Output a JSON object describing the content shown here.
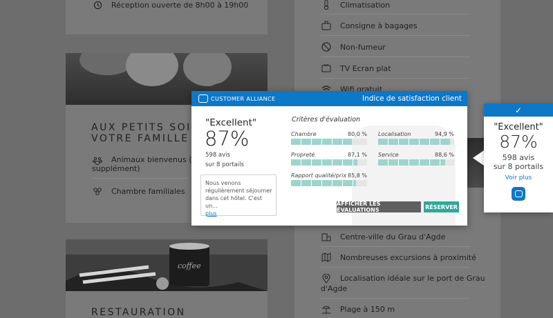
{
  "left_top": {
    "reception": "Réception ouverte de 8h00 à 19h00"
  },
  "section_kids": {
    "heading": "AUX PETITS SOINS POUR VOTRE FAMILLE",
    "heading_line1": "AUX PETITS SOIN",
    "heading_line2": "VOTRE FAMILLE",
    "pets_line1": "Animaux bienvenus (sa",
    "pets_line2": "supplément)",
    "family_rooms": "Chambre familiales"
  },
  "section_restaurant": {
    "heading": "RESTAURATION"
  },
  "right_column": {
    "top_items": [
      {
        "icon": "thermometer-icon",
        "label": "Climatisation"
      },
      {
        "icon": "luggage-icon",
        "label": "Consigne à bagages"
      },
      {
        "icon": "no-smoking-icon",
        "label": "Non-fumeur"
      },
      {
        "icon": "tv-icon",
        "label": "TV Ecran plat"
      },
      {
        "icon": "wifi-icon",
        "label": "Wifi gratuit"
      }
    ],
    "bottom_items": [
      {
        "icon": "building-icon",
        "label": "Centre-ville du Grau d'Agde"
      },
      {
        "icon": "map-icon",
        "label": "Nombreuses excursions à proximité"
      },
      {
        "icon": "location-pin-icon",
        "label_line1": "Localisation idéale sur le port de Grau",
        "label_line2": "d'Agde"
      },
      {
        "icon": "beach-icon",
        "label": "Plage à 150 m"
      }
    ]
  },
  "popup": {
    "brand": "CUSTOMER ALLIANCE",
    "title": "Indice de satisfaction client",
    "rating_label": "\"Excellent\"",
    "score": "87%",
    "reviews": "598 avis",
    "portals": "sur 8 portails",
    "review_excerpt": "Nous venons régulièrement séjourner dans cet hôtel. C'est un...",
    "review_more": "plus",
    "criteria_title": "Critères d'évaluation",
    "criteria": [
      {
        "label": "Chambre",
        "value_text": "80,0 %",
        "value": 80.0
      },
      {
        "label": "Localisation",
        "value_text": "94,9 %",
        "value": 94.9
      },
      {
        "label": "Propreté",
        "value_text": "87,1 %",
        "value": 87.1
      },
      {
        "label": "Service",
        "value_text": "88,6 %",
        "value": 88.6
      },
      {
        "label": "Rapport qualité/prix",
        "value_text": "85,8 %",
        "value": 85.8
      }
    ],
    "show_reviews_button": "AFFICHER LES ÉVALUATIONS",
    "book_button": "RÉSERVER",
    "colors": {
      "header": "#0d77c8",
      "bar": "#9fd4cc",
      "book": "#2fa89a",
      "show": "#5f5f5f"
    }
  },
  "widget": {
    "check": "✓",
    "rating_label": "\"Excellent\"",
    "score": "87%",
    "reviews": "598 avis",
    "portals": "sur 8 portails",
    "link": "Voir plus"
  }
}
